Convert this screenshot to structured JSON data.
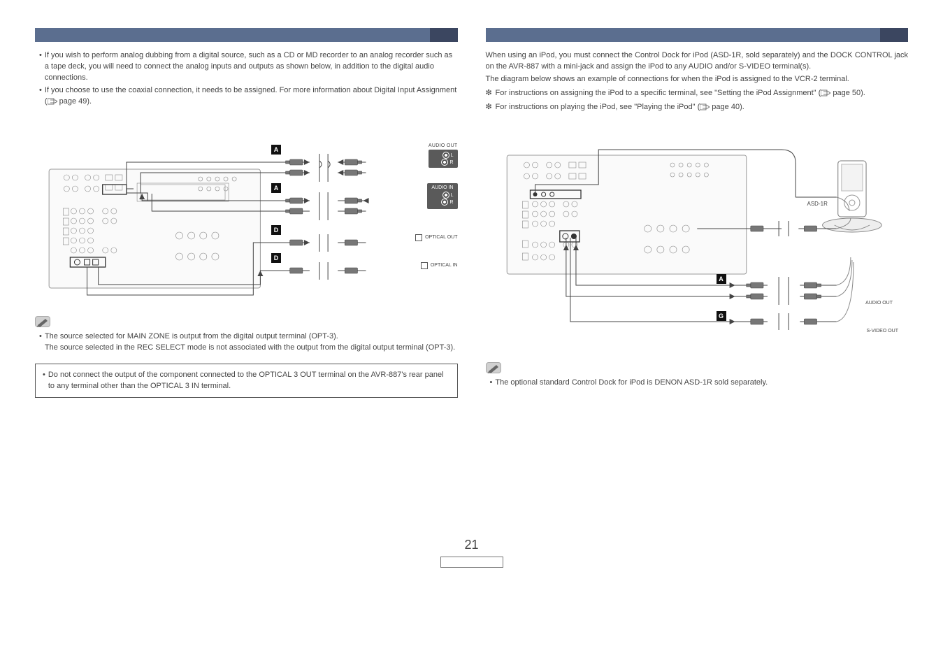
{
  "left": {
    "intro1": "If you wish to perform analog dubbing from a digital source, such as a CD or MD recorder to an analog recorder such as a tape deck, you will need to connect the analog inputs and outputs as shown below, in addition to the digital audio connections.",
    "intro2_a": "If you choose to use the coaxial connection, it needs to be assigned. For more information about Digital Input Assignment (",
    "intro2_b": " page 49).",
    "note1_a": "The source selected for MAIN ZONE is output from the digital output terminal (OPT-3).",
    "note1_b": "The source selected in the REC SELECT mode is not associated with the output from the digital output terminal (OPT-3).",
    "note2": "Do not connect the output of the component connected to the OPTICAL 3 OUT terminal on the AVR-887's rear panel to any terminal other than the OPTICAL 3 IN terminal.",
    "diagram": {
      "badge_A": "A",
      "badge_D": "D",
      "audio_out": "AUDIO OUT",
      "audio_in": "AUDIO IN",
      "l": "L",
      "r": "R",
      "opt_out": "OPTICAL OUT",
      "opt_in": "OPTICAL IN"
    }
  },
  "right": {
    "intro1": "When using an iPod, you must connect the Control Dock for iPod (ASD-1R, sold separately) and the DOCK CONTROL jack on the AVR-887 with a mini-jack and assign the iPod to any AUDIO and/or S-VIDEO terminal(s).",
    "intro2": "The diagram below shows an example of connections for when the iPod is assigned to the VCR-2 terminal.",
    "star1_a": "For instructions on assigning the iPod to a specific terminal, see \"Setting the iPod Assignment\" (",
    "star1_b": " page 50).",
    "star2_a": "For instructions on playing the iPod, see \"Playing the iPod\" (",
    "star2_b": " page 40).",
    "note": "The optional standard Control Dock for iPod is DENON ASD-1R sold separately.",
    "diagram": {
      "asd": "ASD-1R",
      "badge_A": "A",
      "badge_G": "G",
      "audio_out": "AUDIO OUT",
      "svideo_out": "S-VIDEO OUT"
    }
  },
  "page_number": "21",
  "bullet_glyph": "•",
  "star_glyph": "❇"
}
